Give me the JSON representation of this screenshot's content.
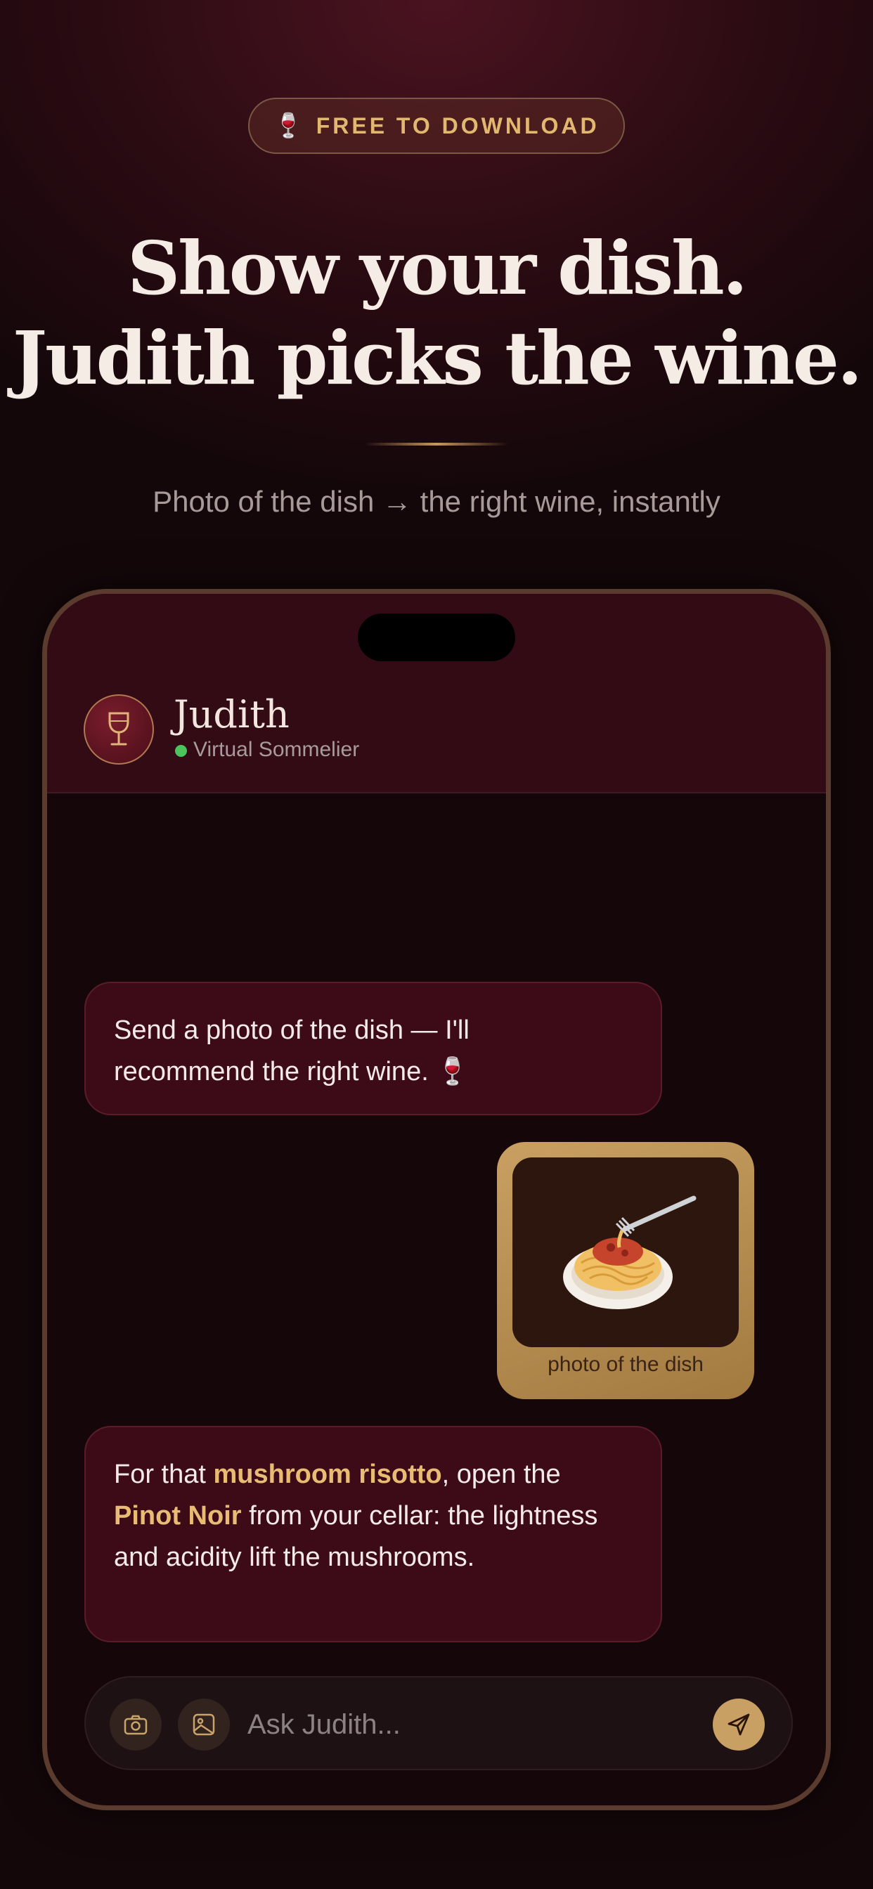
{
  "promo": {
    "badge_icon": "🍷",
    "badge_label": "FREE TO DOWNLOAD",
    "headline_line1": "Show your dish.",
    "headline_line2": "Judith picks the wine.",
    "subtitle": "Photo of the dish → the right wine, instantly"
  },
  "chat": {
    "contact": {
      "avatar_icon": "wine-glass-icon",
      "name": "Judith",
      "role": "Virtual Sommelier",
      "status_color": "#4cc35d"
    },
    "messages": [
      {
        "from": "assistant",
        "text_a": "Send a photo of the dish — I'll",
        "text_b": "recommend the right wine. 🍷"
      },
      {
        "from": "user",
        "image_icon": "🍝",
        "caption": "photo of the dish"
      },
      {
        "from": "assistant",
        "p1": "For that ",
        "hl1": "mushroom risotto",
        "p2": ", open the ",
        "hl2": "Pinot Noir",
        "p3": " from your cellar: the lightness and acidity lift the mushrooms."
      }
    ],
    "composer": {
      "camera_icon": "camera-icon",
      "gallery_icon": "image-icon",
      "placeholder": "Ask Judith...",
      "send_icon": "send-icon"
    }
  },
  "colors": {
    "accent_gold": "#e2b870",
    "bubble_bg": "#3c0b17",
    "highlight": "#e8bd73"
  }
}
